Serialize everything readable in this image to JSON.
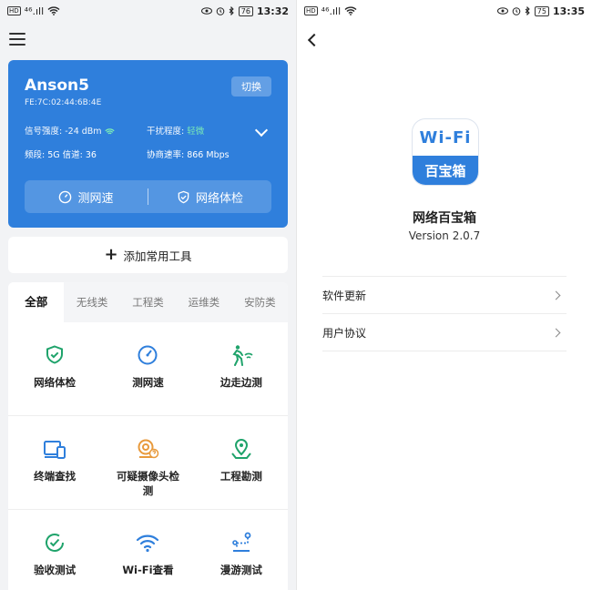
{
  "left": {
    "status": {
      "badge": "HD",
      "signal": "⁴⁶.ıll",
      "battery": "76",
      "time": "13:32"
    },
    "wifi": {
      "ssid": "Anson5",
      "mac": "FE:7C:02:44:6B:4E",
      "switch_label": "切换",
      "signal_label": "信号强度: -24 dBm",
      "interference_label": "干扰程度:",
      "interference_value": "轻微",
      "band_label": "频段: 5G 信道: 36",
      "rate_label": "协商速率: 866 Mbps",
      "speed_test": "测网速",
      "health_check": "网络体检"
    },
    "add_tool": "添加常用工具",
    "tabs": [
      "全部",
      "无线类",
      "工程类",
      "运维类",
      "安防类"
    ],
    "tools": [
      {
        "label": "网络体检",
        "icon": "shield-check-icon"
      },
      {
        "label": "测网速",
        "icon": "speedometer-icon"
      },
      {
        "label": "边走边测",
        "icon": "walking-wifi-icon"
      },
      {
        "label": "终端查找",
        "icon": "devices-icon"
      },
      {
        "label": "可疑摄像头检测",
        "icon": "camera-alert-icon"
      },
      {
        "label": "工程勘测",
        "icon": "map-pin-icon"
      },
      {
        "label": "验收测试",
        "icon": "check-circle-icon"
      },
      {
        "label": "Wi-Fi查看",
        "icon": "wifi-icon"
      },
      {
        "label": "漫游测试",
        "icon": "roaming-icon"
      }
    ],
    "colors": {
      "primary": "#2f7fdc",
      "tool_green": "#1fa36b",
      "tool_blue": "#2f7fdc",
      "tool_orange": "#e89a3c"
    }
  },
  "right": {
    "status": {
      "badge": "HD",
      "signal": "⁴⁶.ıll",
      "battery": "75",
      "time": "13:35"
    },
    "logo_top": "Wi-Fi",
    "logo_bottom": "百宝箱",
    "app_name": "网络百宝箱",
    "version": "Version 2.0.7",
    "rows": [
      "软件更新",
      "用户协议"
    ]
  }
}
